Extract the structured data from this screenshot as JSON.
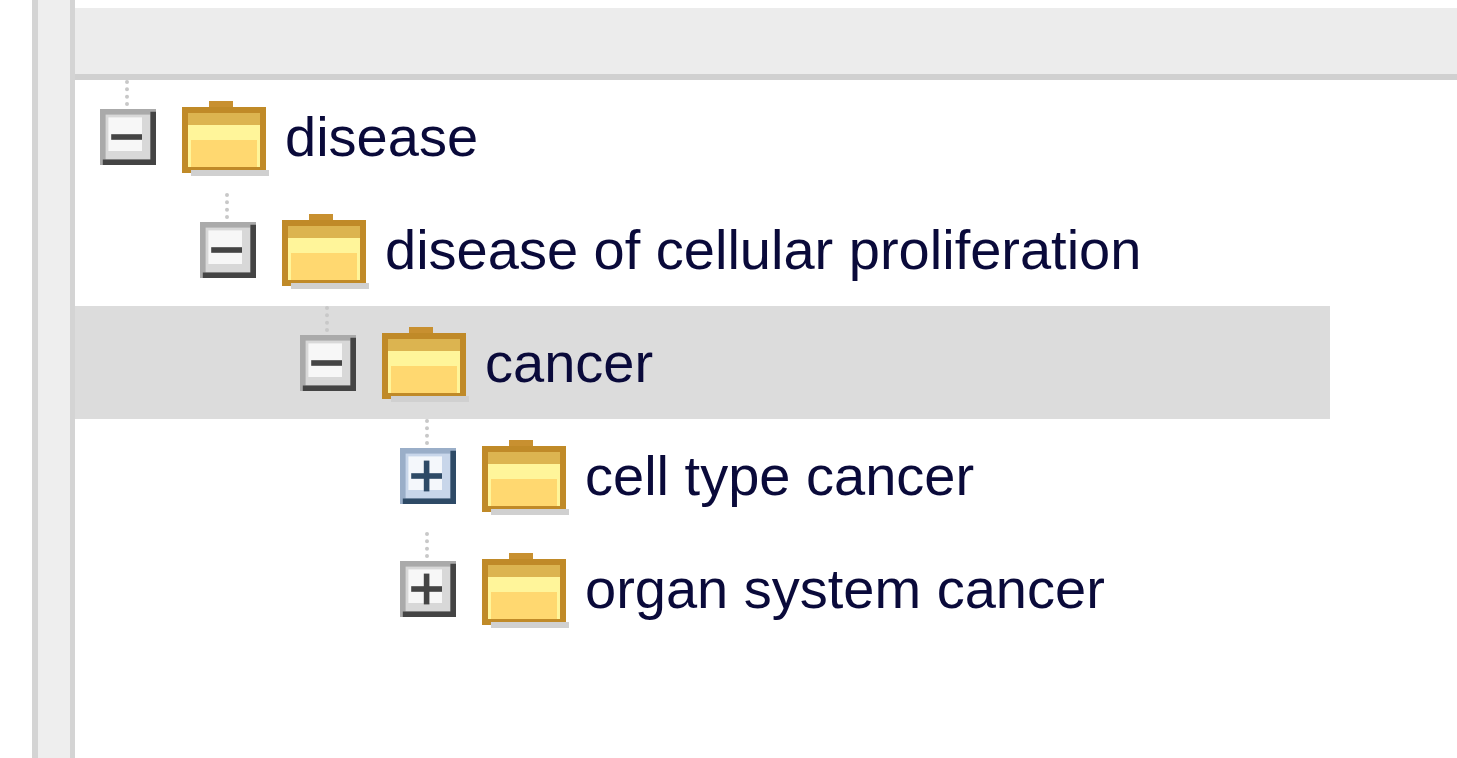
{
  "tree": [
    {
      "label": "disease",
      "expanded": true,
      "selected": false,
      "hovered": false,
      "children": [
        {
          "label": "disease of cellular proliferation",
          "expanded": true,
          "selected": false,
          "hovered": false,
          "children": [
            {
              "label": "cancer",
              "expanded": true,
              "selected": true,
              "hovered": false,
              "children": [
                {
                  "label": "cell type cancer",
                  "expanded": false,
                  "selected": false,
                  "hovered": true
                },
                {
                  "label": "organ system cancer",
                  "expanded": false,
                  "selected": false,
                  "hovered": false
                }
              ]
            }
          ]
        }
      ]
    }
  ]
}
